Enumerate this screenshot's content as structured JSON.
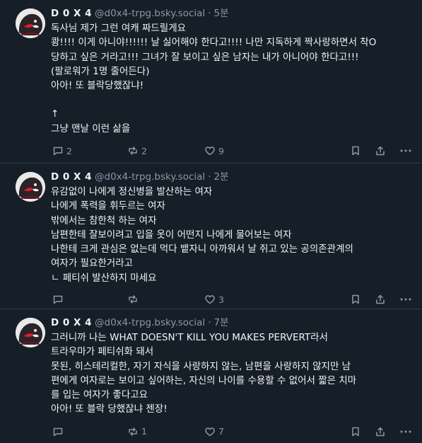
{
  "posts": [
    {
      "author": "D 0 X 4",
      "handle": "@d0x4-trpg.bsky.social",
      "time": "5분",
      "lines": [
        "독사님 제가 그런 여캐 짜드릴게요",
        "쾅!!!! 이게 아니야!!!!!! 날 싫어해야 한다고!!!! 나만 지독하게 짝사랑하면서 착O",
        "당하고 싶은 거라고!!! 그녀가 잘 보이고 싶은 남자는 내가 아니어야 한다고!!!",
        "(팔로워가 1명 줄어든다)",
        "아아! 또 블락당했잖냐!",
        "",
        "↑",
        "그냥 맨날 이런 삶을"
      ],
      "replies": "2",
      "reposts": "2",
      "likes": "9"
    },
    {
      "author": "D 0 X 4",
      "handle": "@d0x4-trpg.bsky.social",
      "time": "2분",
      "lines": [
        "유감없이 나에게 정신병을 발산하는 여자",
        "나에게 폭력을 휘두르는 여자",
        "밖에서는 참한척 하는 여자",
        "남편한테 잘보이려고 입을 옷이 어떤지 나에게 물어보는 여자",
        "나한테 크게 관심은 없는데 먹다 뱉자니 아까워서 날 쥐고 있는 공의존관계의",
        "여자가 필요한거라고",
        "ㄴ 페티쉬 발산하지 마세요"
      ],
      "replies": "",
      "reposts": "",
      "likes": "3"
    },
    {
      "author": "D 0 X 4",
      "handle": "@d0x4-trpg.bsky.social",
      "time": "7분",
      "lines": [
        "그러니까 나는 WHAT DOESN'T KILL YOU MAKES PERVERT라서",
        "트라우마가 페티쉬화 돼서",
        "못된, 히스테리컬한, 자기 자식을 사랑하지 않는, 남편을 사랑하지 않지만 남",
        "편에게 여자로는 보이고 싶어하는, 자신의 나이를 수용할 수 없어서 짧은 치마",
        "를 입는 여자가 좋다고요",
        "아아! 또 블락 당했잖냐 젠장!"
      ],
      "replies": "",
      "reposts": "1",
      "likes": "7"
    }
  ],
  "icons": {
    "reply": "speech-bubble-icon",
    "repost": "repost-arrows-icon",
    "like": "heart-icon",
    "bookmark": "bookmark-icon",
    "share": "share-icon",
    "more": "more-dots-icon"
  },
  "colors": {
    "background": "#161e27",
    "text": "#f1f3f5",
    "muted": "#8b98a5",
    "divider": "#2e3d4d"
  }
}
